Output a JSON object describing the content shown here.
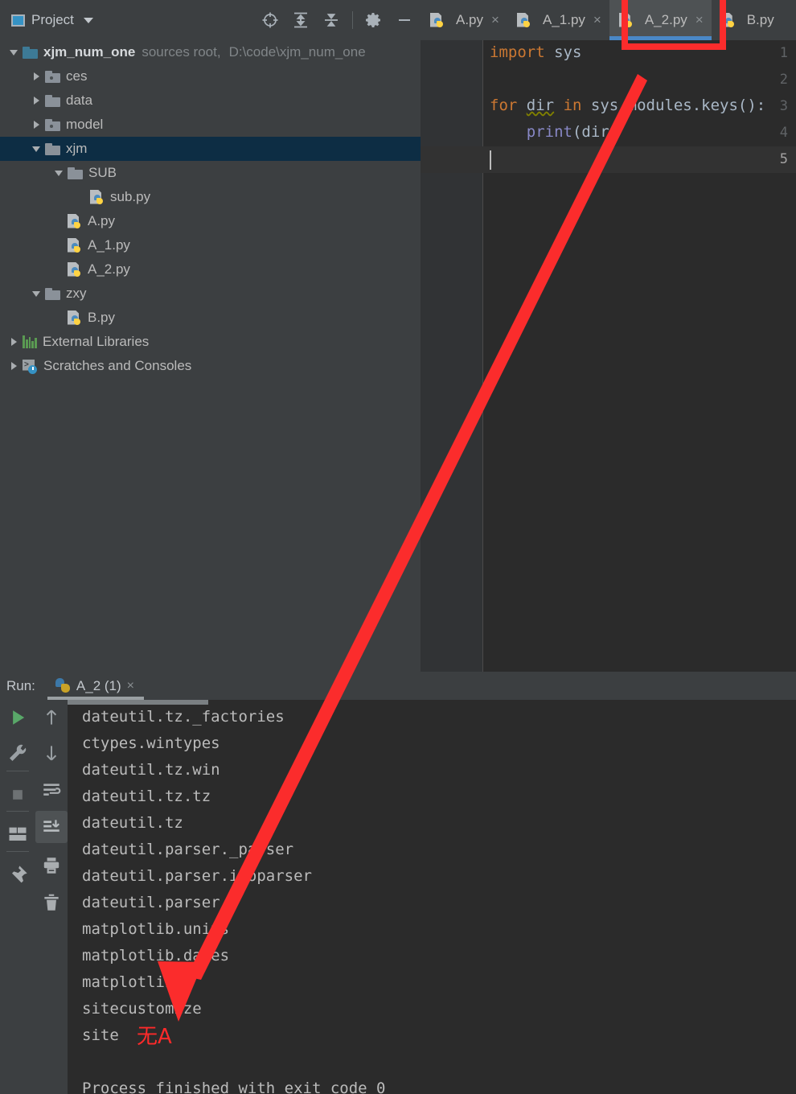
{
  "project_panel": {
    "title": "Project",
    "toolbar_icons": [
      "locate-target-icon",
      "expand-all-icon",
      "collapse-all-icon",
      "settings-gear-icon",
      "minimize-icon"
    ],
    "tree": [
      {
        "label": "xjm_num_one",
        "suffix": "sources root,",
        "suffix2": "D:\\code\\xjm_num_one",
        "kind": "root-folder",
        "indent": 0,
        "twisty": "down",
        "selected": false
      },
      {
        "label": "ces",
        "kind": "folder-dot",
        "indent": 1,
        "twisty": "right",
        "selected": false
      },
      {
        "label": "data",
        "kind": "folder",
        "indent": 1,
        "twisty": "right",
        "selected": false
      },
      {
        "label": "model",
        "kind": "folder-dot",
        "indent": 1,
        "twisty": "right",
        "selected": false
      },
      {
        "label": "xjm",
        "kind": "folder",
        "indent": 1,
        "twisty": "down",
        "selected": true
      },
      {
        "label": "SUB",
        "kind": "folder",
        "indent": 2,
        "twisty": "down",
        "selected": false
      },
      {
        "label": "sub.py",
        "kind": "python",
        "indent": 3,
        "twisty": "none",
        "selected": false
      },
      {
        "label": "A.py",
        "kind": "python",
        "indent": 2,
        "twisty": "none",
        "selected": false
      },
      {
        "label": "A_1.py",
        "kind": "python",
        "indent": 2,
        "twisty": "none",
        "selected": false
      },
      {
        "label": "A_2.py",
        "kind": "python",
        "indent": 2,
        "twisty": "none",
        "selected": false
      },
      {
        "label": "zxy",
        "kind": "folder",
        "indent": 1,
        "twisty": "down",
        "selected": false
      },
      {
        "label": "B.py",
        "kind": "python",
        "indent": 2,
        "twisty": "none",
        "selected": false
      },
      {
        "label": "External Libraries",
        "kind": "libraries",
        "indent": 0,
        "twisty": "right",
        "selected": false
      },
      {
        "label": "Scratches and Consoles",
        "kind": "scratches",
        "indent": 0,
        "twisty": "right",
        "selected": false
      }
    ]
  },
  "editor": {
    "tabs": [
      {
        "label": "A.py",
        "active": false,
        "closable": true
      },
      {
        "label": "A_1.py",
        "active": false,
        "closable": true
      },
      {
        "label": "A_2.py",
        "active": true,
        "closable": true
      },
      {
        "label": "B.py",
        "active": false,
        "closable": false
      }
    ],
    "close_glyph": "×",
    "line_numbers": [
      "1",
      "2",
      "3",
      "4",
      "5"
    ],
    "current_line": 5,
    "code_lines": [
      {
        "n": 1,
        "tokens": [
          {
            "t": "import",
            "c": "kw"
          },
          {
            "t": " sys",
            "c": "pl"
          }
        ]
      },
      {
        "n": 2,
        "tokens": []
      },
      {
        "n": 3,
        "tokens": [
          {
            "t": "for",
            "c": "kw"
          },
          {
            "t": " ",
            "c": "pl"
          },
          {
            "t": "dir",
            "c": "wavy"
          },
          {
            "t": " ",
            "c": "pl"
          },
          {
            "t": "in",
            "c": "kw"
          },
          {
            "t": " sys.modules.keys():",
            "c": "pl"
          }
        ]
      },
      {
        "n": 4,
        "tokens": [
          {
            "t": "    ",
            "c": "pl"
          },
          {
            "t": "print",
            "c": "fn"
          },
          {
            "t": "(dir)",
            "c": "pl"
          }
        ]
      },
      {
        "n": 5,
        "tokens": []
      }
    ]
  },
  "run_panel": {
    "label": "Run:",
    "tab_label": "A_2 (1)",
    "tab_close_glyph": "×",
    "left_buttons": [
      "run-icon",
      "wrench-icon",
      "stop-icon",
      "layout-icon",
      "pin-icon"
    ],
    "right_buttons": [
      "scroll-up-icon",
      "scroll-down-icon",
      "soft-wrap-icon",
      "scroll-to-end-icon",
      "print-icon",
      "trash-icon"
    ],
    "selected_right_button": "scroll-to-end-icon",
    "console_lines": [
      "dateutil.tz._factories",
      "ctypes.wintypes",
      "dateutil.tz.win",
      "dateutil.tz.tz",
      "dateutil.tz",
      "dateutil.parser._parser",
      "dateutil.parser.isoparser",
      "dateutil.parser",
      "matplotlib.units",
      "matplotlib.dates",
      "matplotlib",
      "sitecustomize",
      "site",
      "",
      "Process finished with exit code 0"
    ]
  },
  "annotations": {
    "arrow_color": "#fb2c2c",
    "highlight_box_color": "#fb2c2c",
    "note_text": "无A",
    "note_color": "#ff2a2a",
    "box_target": "A_2.py tab"
  },
  "colors": {
    "panel_bg": "#3c3f41",
    "editor_bg": "#2b2b2b",
    "gutter_bg": "#313335",
    "selection_bg": "#0d2d44",
    "tab_active_underline": "#4a88c7",
    "keyword": "#cc7832",
    "plain": "#a9b7c6",
    "function": "#8888c6"
  }
}
